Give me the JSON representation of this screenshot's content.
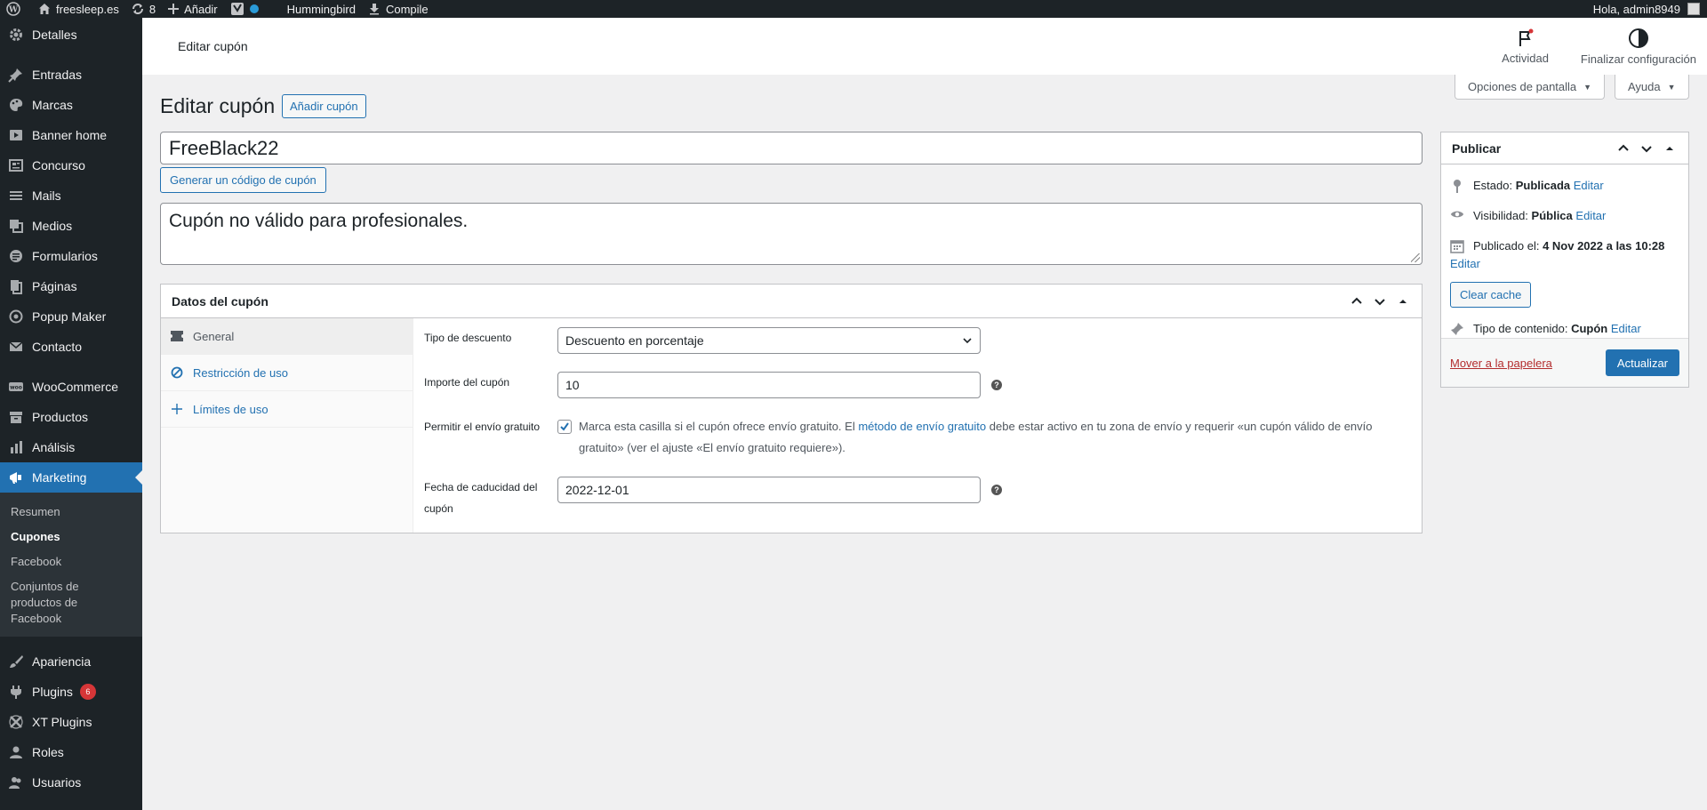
{
  "adminbar": {
    "site_name": "freesleep.es",
    "updates_count": "8",
    "add_new": "Añadir",
    "hummingbird": "Hummingbird",
    "compile": "Compile",
    "greeting": "Hola, admin8949"
  },
  "sidebar": {
    "items": [
      {
        "label": "Detalles",
        "icon": "gear-icon"
      },
      {
        "label": "Entradas",
        "icon": "pin-icon"
      },
      {
        "label": "Marcas",
        "icon": "palette-icon"
      },
      {
        "label": "Banner home",
        "icon": "play-icon"
      },
      {
        "label": "Concurso",
        "icon": "newspaper-icon"
      },
      {
        "label": "Mails",
        "icon": "list-icon"
      },
      {
        "label": "Medios",
        "icon": "media-icon"
      },
      {
        "label": "Formularios",
        "icon": "forms-icon"
      },
      {
        "label": "Páginas",
        "icon": "pages-icon"
      },
      {
        "label": "Popup Maker",
        "icon": "popup-icon"
      },
      {
        "label": "Contacto",
        "icon": "mail-icon"
      },
      {
        "label": "WooCommerce",
        "icon": "woo-icon"
      },
      {
        "label": "Productos",
        "icon": "archive-icon"
      },
      {
        "label": "Análisis",
        "icon": "chart-icon"
      },
      {
        "label": "Marketing",
        "icon": "megaphone-icon"
      },
      {
        "label": "Apariencia",
        "icon": "brush-icon"
      },
      {
        "label": "Plugins",
        "icon": "plug-icon",
        "badge": "6"
      },
      {
        "label": "XT Plugins",
        "icon": "xt-icon"
      },
      {
        "label": "Roles",
        "icon": "user-icon"
      },
      {
        "label": "Usuarios",
        "icon": "users-icon"
      }
    ],
    "submenu": [
      "Resumen",
      "Cupones",
      "Facebook",
      "Conjuntos de productos de Facebook"
    ]
  },
  "header": {
    "title": "Editar cupón",
    "activity": "Actividad",
    "finish_setup": "Finalizar configuración"
  },
  "screen_options": "Opciones de pantalla",
  "help": "Ayuda",
  "page": {
    "title": "Editar cupón",
    "add_coupon": "Añadir cupón",
    "coupon_code": "FreeBlack22",
    "generate_code": "Generar un código de cupón",
    "description": "Cupón no válido para profesionales."
  },
  "coupon_data": {
    "title": "Datos del cupón",
    "tabs": [
      "General",
      "Restricción de uso",
      "Límites de uso"
    ],
    "fields": {
      "discount_type_label": "Tipo de descuento",
      "discount_type_value": "Descuento en porcentaje",
      "amount_label": "Importe del cupón",
      "amount_value": "10",
      "free_shipping_label": "Permitir el envío gratuito",
      "free_shipping_text_before": "Marca esta casilla si el cupón ofrece envío gratuito. El ",
      "free_shipping_link": "método de envío gratuito",
      "free_shipping_text_after": " debe estar activo en tu zona de envío y requerir «un cupón válido de envío gratuito» (ver el ajuste «El envío gratuito requiere»).",
      "expiry_label": "Fecha de caducidad del cupón",
      "expiry_value": "2022-12-01"
    }
  },
  "publish": {
    "title": "Publicar",
    "status_label": "Estado: ",
    "status_value": "Publicada",
    "visibility_label": "Visibilidad: ",
    "visibility_value": "Pública",
    "published_label": "Publicado el: ",
    "published_value": "4 Nov 2022 a las 10:28",
    "edit": "Editar",
    "clear_cache": "Clear cache",
    "content_type_label": "Tipo de contenido: ",
    "content_type_value": "Cupón",
    "trash": "Mover a la papelera",
    "update": "Actualizar"
  },
  "colors": {
    "primary": "#2271b1",
    "adminbar": "#1d2327",
    "danger": "#b32d2e"
  }
}
